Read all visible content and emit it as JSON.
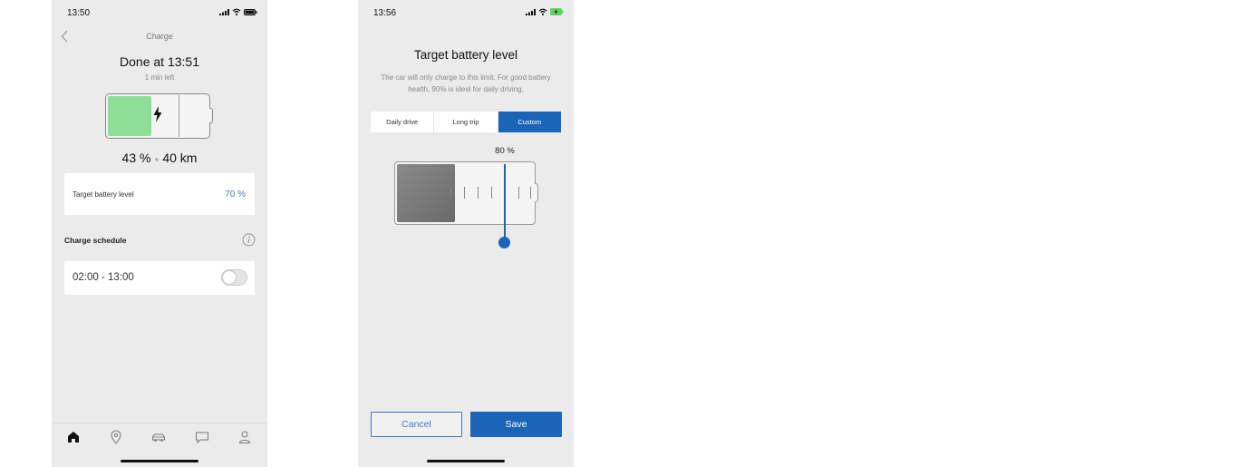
{
  "charge_screen": {
    "status_time": "13:50",
    "nav_title": "Charge",
    "done_text": "Done at 13:51",
    "time_left": "1 min left",
    "battery_percent": "43 %",
    "range": "40 km",
    "battery_level": 0.43,
    "target_label": "Target battery level",
    "target_value": "70 %",
    "schedule_label": "Charge schedule",
    "schedule_time": "02:00 - 13:00",
    "schedule_enabled": false,
    "tabs": [
      "home-icon",
      "location-pin-icon",
      "car-icon",
      "chat-icon",
      "profile-icon"
    ],
    "colors": {
      "battery_fill": "#8ddf97",
      "accent": "#3d7ac0"
    }
  },
  "target_screen": {
    "status_time": "13:56",
    "title": "Target battery level",
    "description": "The car will only charge to this limit. For good battery health, 90% is ideal for daily driving.",
    "segments": [
      "Daily drive",
      "Long trip",
      "Custom"
    ],
    "selected_segment": "Custom",
    "slider_label": "80 %",
    "slider_value": 0.8,
    "cancel_label": "Cancel",
    "save_label": "Save",
    "colors": {
      "primary": "#1b65b8",
      "fill": "#7a7a7a"
    }
  }
}
